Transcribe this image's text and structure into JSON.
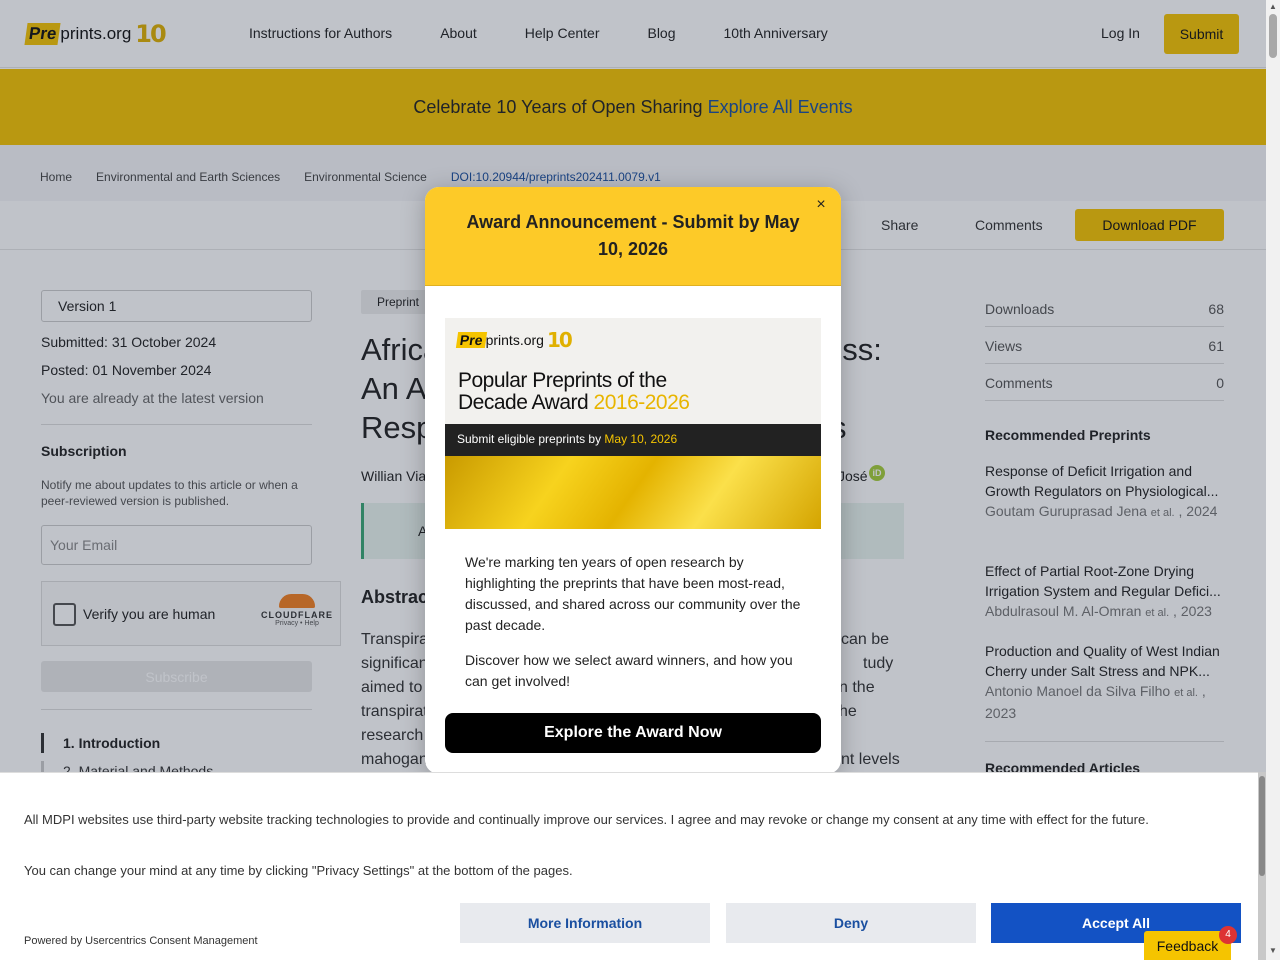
{
  "header": {
    "logo_pre": "Pre",
    "logo_text": "prints.org",
    "logo_ten": "10",
    "nav": [
      "Instructions for Authors",
      "About",
      "Help Center",
      "Blog",
      "10th Anniversary"
    ],
    "login": "Log In",
    "submit": "Submit"
  },
  "banner": {
    "text": "Celebrate 10 Years of Open Sharing",
    "link": "Explore All Events"
  },
  "breadcrumb": [
    "Home",
    "Environmental and Earth Sciences",
    "Environmental Science",
    "DOI:10.20944/preprints202411.0079.v1"
  ],
  "toolbar": {
    "share": "Share",
    "comments": "Comments",
    "download": "Download PDF"
  },
  "left": {
    "version": "Version 1",
    "submitted": "Submitted: 31 October 2024",
    "posted": "Posted: 01 November 2024",
    "latest": "You are already at the latest version",
    "subscription_title": "Subscription",
    "subscription_desc": "Notify me about updates to this article or when a peer-reviewed version is published.",
    "email_placeholder": "Your Email",
    "captcha_label": "Verify you are human",
    "captcha_brand": "CLOUDFLARE",
    "captcha_links": "Privacy • Help",
    "subscribe": "Subscribe",
    "toc": [
      "1. Introduction",
      "2. Material and Methods"
    ]
  },
  "main": {
    "tag": "Preprint",
    "title_lines": [
      "Africa",
      "An A",
      "Resp"
    ],
    "title_tail": [
      "ess:",
      "",
      "s"
    ],
    "authors": "Willian Via",
    "authors_tail": "José",
    "notice": "A",
    "abstract_heading": "Abstract",
    "abstract_lines": [
      "Transpira",
      "significan",
      "aimed to",
      "transpirat",
      "research",
      "mahogany"
    ],
    "abstract_tail": [
      "can be",
      "tudy",
      "n the",
      "he",
      "",
      "nt levels"
    ]
  },
  "stats": [
    {
      "label": "Downloads",
      "value": "68"
    },
    {
      "label": "Views",
      "value": "61"
    },
    {
      "label": "Comments",
      "value": "0"
    }
  ],
  "recommended": {
    "heading": "Recommended Preprints",
    "items": [
      {
        "title": "Response of Deficit Irrigation and Growth Regulators on Physiological...",
        "author": "Goutam Guruprasad Jena",
        "etal": "et al.",
        "year": ", 2024"
      },
      {
        "title": "Effect of Partial Root-Zone Drying Irrigation System and Regular Defici...",
        "author": "Abdulrasoul M. Al-Omran",
        "etal": "et al.",
        "year": ", 2023"
      },
      {
        "title": "Production and Quality of West Indian Cherry under Salt Stress and NPK...",
        "author": "Antonio Manoel da Silva Filho",
        "etal": "et al.",
        "year": ", 2023"
      }
    ],
    "articles_heading": "Recommended Articles"
  },
  "modal": {
    "title": "Award Announcement - Submit by May 10, 2026",
    "close": "×",
    "image": {
      "logo_pre": "Pre",
      "logo_text": "prints.org",
      "logo_ten": "10",
      "headline1": "Popular Preprints of the",
      "headline2": "Decade Award",
      "years": "2016-2026",
      "band_text": "Submit eligible preprints by",
      "band_date": "May 10, 2026"
    },
    "p1": "We're marking ten years of open research by highlighting the preprints that have been most-read, discussed, and shared across our community over the past decade.",
    "p2": "Discover how we select award winners, and how you can get involved!",
    "cta": "Explore the Award Now"
  },
  "cookie": {
    "p1": "All MDPI websites use third-party website tracking technologies to provide and continually improve our services. I agree and may revoke or change my consent at any time with effect for the future.",
    "p2": "You can change your mind at any time by clicking \"Privacy Settings\" at the bottom of the pages.",
    "powered": "Powered by Usercentrics Consent Management",
    "more": "More Information",
    "deny": "Deny",
    "accept": "Accept All"
  },
  "feedback": {
    "label": "Feedback",
    "count": "4"
  },
  "colors": {
    "brand_yellow": "#f5c400",
    "modal_yellow": "#fdca28",
    "accept_blue": "#1352c4",
    "link_blue": "#1a4fa0"
  }
}
